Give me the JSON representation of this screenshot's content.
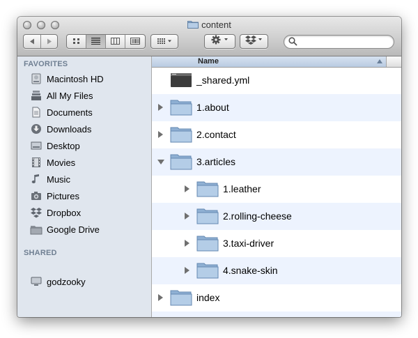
{
  "window": {
    "title": "content"
  },
  "toolbar": {
    "back_icon": "back-arrow-icon",
    "forward_icon": "forward-arrow-icon",
    "views": [
      "icon-view-icon",
      "list-view-icon",
      "column-view-icon",
      "coverflow-view-icon"
    ],
    "active_view": "list-view-icon",
    "arrange_icon": "arrange-grid-icon",
    "action_icon": "gear-icon",
    "dropbox_icon": "dropbox-icon",
    "search": {
      "placeholder": "",
      "value": ""
    }
  },
  "sidebar": {
    "favorites_header": "FAVORITES",
    "favorites": [
      {
        "label": "Macintosh HD",
        "icon": "hard-drive-icon"
      },
      {
        "label": "All My Files",
        "icon": "all-files-icon"
      },
      {
        "label": "Documents",
        "icon": "documents-icon"
      },
      {
        "label": "Downloads",
        "icon": "downloads-icon"
      },
      {
        "label": "Desktop",
        "icon": "desktop-icon"
      },
      {
        "label": "Movies",
        "icon": "movies-icon"
      },
      {
        "label": "Music",
        "icon": "music-icon"
      },
      {
        "label": "Pictures",
        "icon": "pictures-icon"
      },
      {
        "label": "Dropbox",
        "icon": "dropbox-icon"
      },
      {
        "label": "Google Drive",
        "icon": "folder-icon"
      }
    ],
    "shared_header": "SHARED",
    "shared": [
      {
        "label": "godzooky",
        "icon": "computer-icon",
        "eject_icon": "eject-icon"
      }
    ]
  },
  "list": {
    "column_header": "Name",
    "sort": "ascending",
    "rows": [
      {
        "name": "_shared.yml",
        "kind": "file",
        "level": 0,
        "disclosure": "none"
      },
      {
        "name": "1.about",
        "kind": "folder",
        "level": 0,
        "disclosure": "closed"
      },
      {
        "name": "2.contact",
        "kind": "folder",
        "level": 0,
        "disclosure": "closed"
      },
      {
        "name": "3.articles",
        "kind": "folder",
        "level": 0,
        "disclosure": "open"
      },
      {
        "name": "1.leather",
        "kind": "folder",
        "level": 1,
        "disclosure": "closed"
      },
      {
        "name": "2.rolling-cheese",
        "kind": "folder",
        "level": 1,
        "disclosure": "closed"
      },
      {
        "name": "3.taxi-driver",
        "kind": "folder",
        "level": 1,
        "disclosure": "closed"
      },
      {
        "name": "4.snake-skin",
        "kind": "folder",
        "level": 1,
        "disclosure": "closed"
      },
      {
        "name": "index",
        "kind": "folder",
        "level": 0,
        "disclosure": "closed"
      }
    ]
  }
}
